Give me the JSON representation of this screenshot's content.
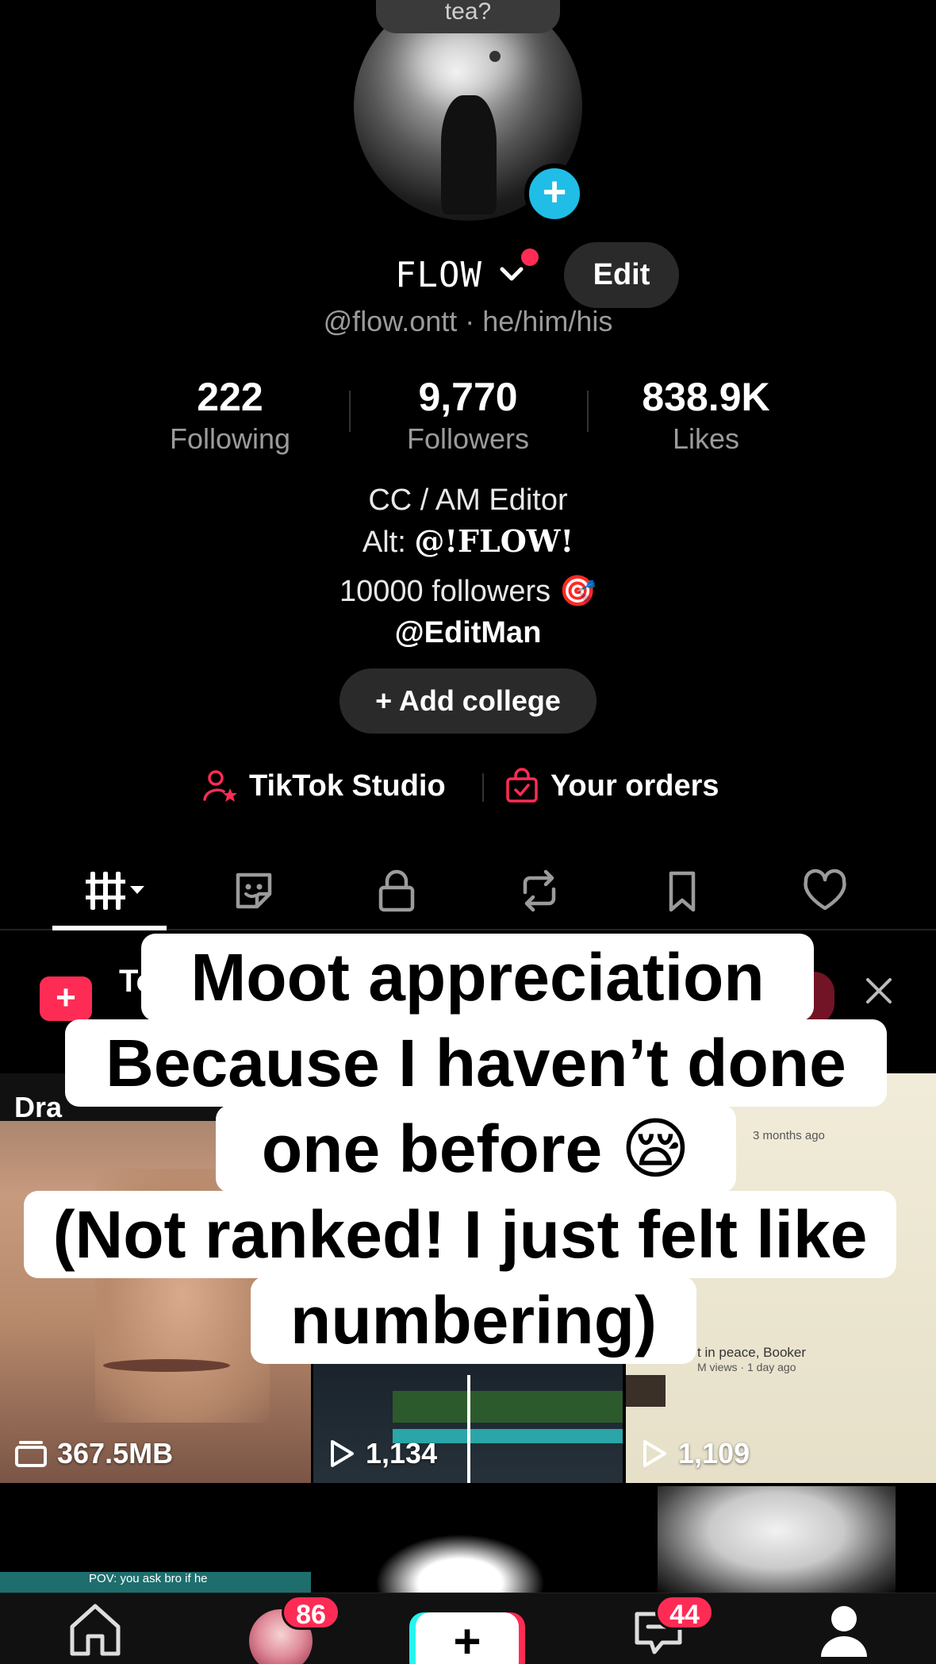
{
  "profile": {
    "note_text": "tea?",
    "display_name": "FLOW",
    "edit_label": "Edit",
    "handle_line": "@flow.ontt · he/him/his"
  },
  "stats": [
    {
      "value": "222",
      "label": "Following"
    },
    {
      "value": "9,770",
      "label": "Followers"
    },
    {
      "value": "838.9K",
      "label": "Likes"
    }
  ],
  "bio": {
    "line1": "CC / AM Editor",
    "line2_prefix": "Alt: ",
    "line2_alt": "@!FLOW!",
    "line3": "10000 followers 🎯",
    "line4": "@EditMan"
  },
  "add_college_label": "+ Add college",
  "studio": {
    "tiktok_studio": "TikTok Studio",
    "your_orders": "Your orders"
  },
  "banner": {
    "text_fragment": "To"
  },
  "grid": {
    "drafts_label": "Dra",
    "cell1_size": "367.5MB",
    "cell2_views": "1,134",
    "cell3_views": "1,109",
    "cell3_ago": "3 months ago",
    "cell3_title": "t in peace, Booker",
    "cell3_meta": "M views · 1 day ago",
    "cell4_pov": "POV: you ask bro if he"
  },
  "caption": {
    "line1": "Moot appreciation",
    "line2": "Because I haven’t done",
    "line3": "one before 😪",
    "line4": "(Not ranked! I just felt like",
    "line5": "numbering)"
  },
  "nav": {
    "friends_badge": "86",
    "inbox_badge": "44",
    "create_label": "+"
  },
  "colors": {
    "accent_red": "#fe2c55",
    "accent_cyan": "#20bde6"
  }
}
